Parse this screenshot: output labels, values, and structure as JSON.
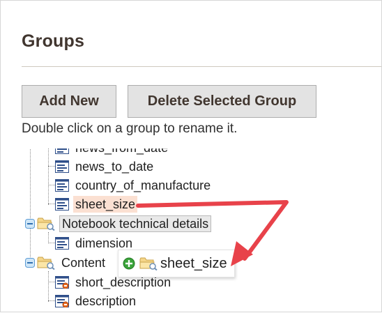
{
  "page": {
    "title": "Groups"
  },
  "buttons": {
    "add_new": "Add New",
    "delete_selected_group": "Delete Selected Group"
  },
  "hint": "Double click on a group to rename it.",
  "tree": {
    "attributes_top": [
      {
        "label": "news_from_date"
      },
      {
        "label": "news_to_date"
      },
      {
        "label": "country_of_manufacture"
      },
      {
        "label": "sheet_size"
      }
    ],
    "group_notebook": {
      "label": "Notebook technical details",
      "children": [
        {
          "label": "dimension"
        }
      ]
    },
    "group_content": {
      "label": "Content",
      "children": [
        {
          "label": "short_description"
        },
        {
          "label": "description"
        }
      ]
    }
  },
  "drag_ghost": {
    "label": "sheet_size"
  },
  "colors": {
    "highlight_drag_source": "#fbe0d2",
    "annotation_arrow": "#e8424a",
    "add_badge": "#3aa33a"
  },
  "icons": {
    "attribute": "attribute-icon",
    "attribute_system": "system-attribute-icon",
    "folder": "folder-icon",
    "toggle": "collapse-toggle-icon",
    "add": "add-badge-icon"
  }
}
